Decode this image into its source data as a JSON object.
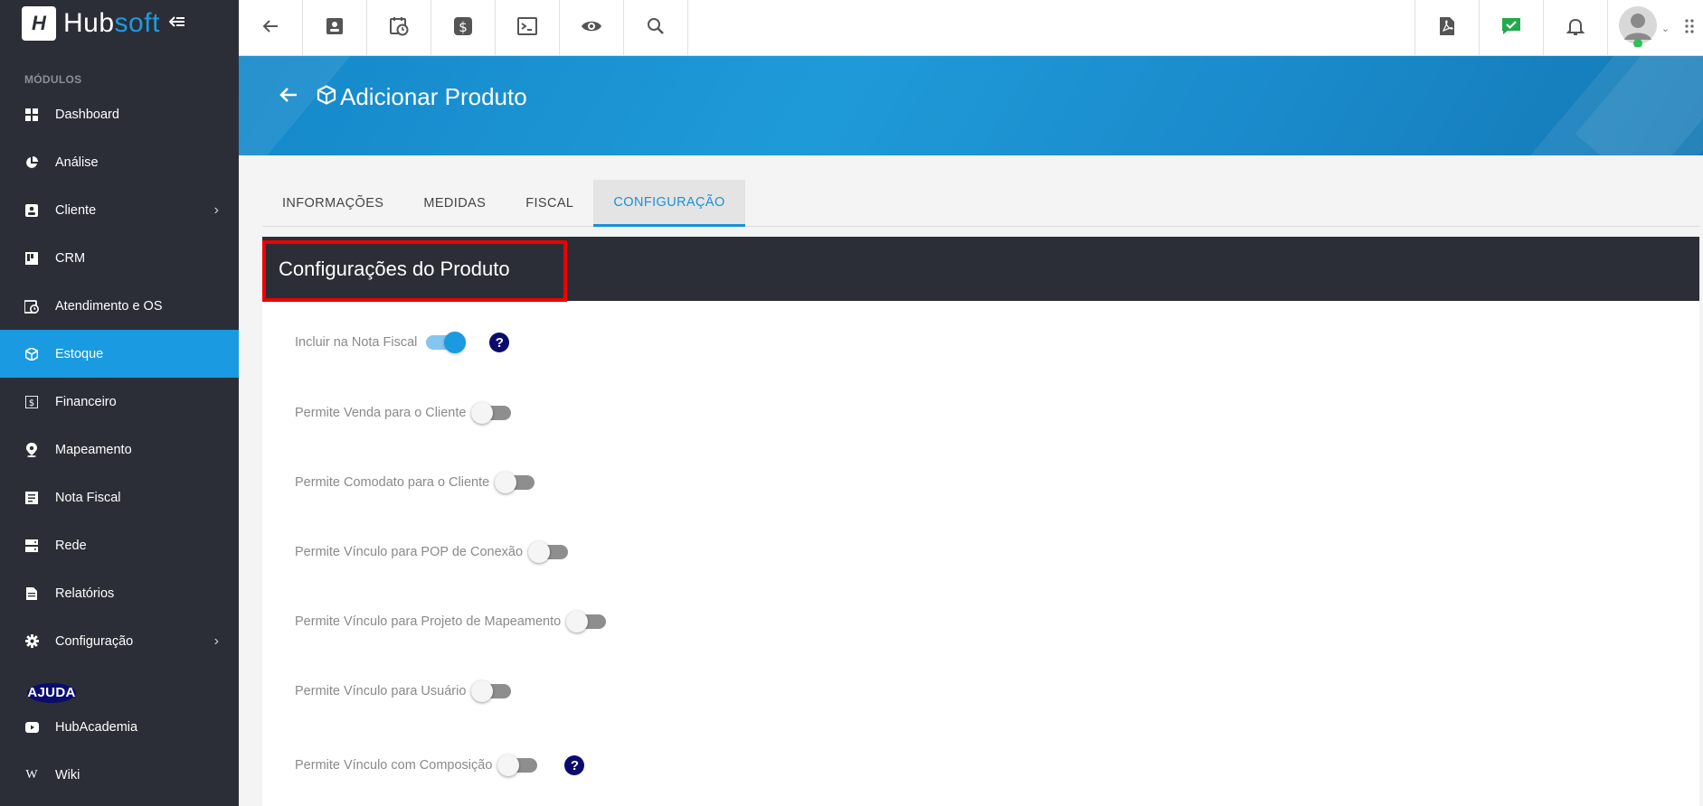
{
  "app": {
    "logo_mark": "H",
    "logo_text_1": "Hub",
    "logo_text_2": "soft"
  },
  "sidebar": {
    "section_modules": "MÓDULOS",
    "section_help": "AJUDA",
    "items": [
      {
        "label": "Dashboard",
        "icon": "dashboard-icon"
      },
      {
        "label": "Análise",
        "icon": "pie-chart-icon"
      },
      {
        "label": "Cliente",
        "icon": "contact-card-icon",
        "has_submenu": true
      },
      {
        "label": "CRM",
        "icon": "kanban-icon"
      },
      {
        "label": "Atendimento e OS",
        "icon": "calendar-clock-icon"
      },
      {
        "label": "Estoque",
        "icon": "package-icon",
        "active": true
      },
      {
        "label": "Financeiro",
        "icon": "dollar-box-icon"
      },
      {
        "label": "Mapeamento",
        "icon": "map-pin-icon"
      },
      {
        "label": "Nota Fiscal",
        "icon": "invoice-icon"
      },
      {
        "label": "Rede",
        "icon": "server-icon"
      },
      {
        "label": "Relatórios",
        "icon": "report-icon"
      },
      {
        "label": "Configuração",
        "icon": "gear-icon",
        "has_submenu": true
      }
    ],
    "help_items": [
      {
        "label": "HubAcademia",
        "icon": "youtube-icon"
      },
      {
        "label": "Wiki",
        "icon": "wikipedia-icon",
        "glyph": "W"
      }
    ]
  },
  "topbar": {
    "left_icons": [
      "back-arrow-icon",
      "contact-card-icon",
      "calendar-clock-icon",
      "dollar-box-icon",
      "terminal-icon",
      "eye-icon",
      "search-icon"
    ],
    "right_icons": [
      "pdf-icon",
      "chat-check-icon",
      "bell-icon",
      "avatar"
    ]
  },
  "page": {
    "title": "Adicionar Produto"
  },
  "tabs": [
    {
      "label": "INFORMAÇÕES",
      "active": false
    },
    {
      "label": "MEDIDAS",
      "active": false
    },
    {
      "label": "FISCAL",
      "active": false
    },
    {
      "label": "CONFIGURAÇÃO",
      "active": true
    }
  ],
  "card": {
    "title": "Configurações do Produto",
    "help_glyph": "?",
    "options": [
      {
        "label": "Incluir na Nota Fiscal",
        "on": true,
        "help": true
      },
      {
        "label": "Permite Venda para o Cliente",
        "on": false
      },
      {
        "label": "Permite Comodato para o Cliente",
        "on": false
      },
      {
        "label": "Permite Vínculo para POP de Conexão",
        "on": false
      },
      {
        "label": "Permite Vínculo para Projeto de Mapeamento",
        "on": false
      },
      {
        "label": "Permite Vínculo para Usuário",
        "on": false
      },
      {
        "label": "Permite Vínculo com Composição",
        "on": false,
        "help": true
      }
    ]
  },
  "colors": {
    "accent": "#1a9ae0",
    "sidebar_bg": "#2b2e36",
    "highlight_border": "#ee0000"
  }
}
